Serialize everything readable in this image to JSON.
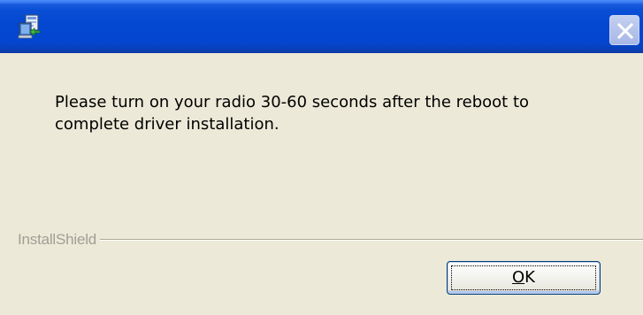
{
  "window": {
    "title": "",
    "app_icon": "installer-icon",
    "close_icon": "close-icon"
  },
  "message": {
    "line1": "Please turn on your radio 30-60 seconds after the reboot to",
    "line2": "complete driver installation."
  },
  "footer": {
    "brand": "InstallShield"
  },
  "buttons": {
    "ok_mnemonic": "O",
    "ok_rest": "K"
  },
  "colors": {
    "titlebar": "#0346d0",
    "background": "#ece9d8",
    "brand_text": "#a09f94"
  }
}
